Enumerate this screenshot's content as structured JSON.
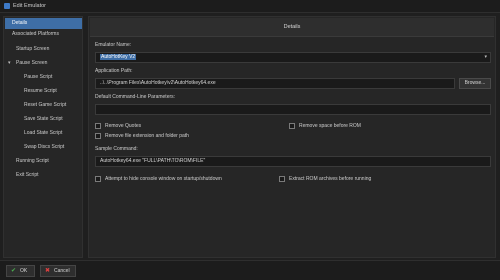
{
  "window": {
    "title": "Edit Emulator"
  },
  "sidebar": {
    "items": [
      {
        "label": "Details",
        "active": true
      },
      {
        "label": "Associated Platforms"
      },
      {
        "label": "Startup Screen"
      },
      {
        "label": "Pause Screen",
        "expandable": true
      },
      {
        "label": "Pause Script"
      },
      {
        "label": "Resume Script"
      },
      {
        "label": "Reset Game Script"
      },
      {
        "label": "Save State Script"
      },
      {
        "label": "Load State Script"
      },
      {
        "label": "Swap Discs Script"
      },
      {
        "label": "Running Script"
      },
      {
        "label": "Exit Script"
      }
    ]
  },
  "main": {
    "header": "Details",
    "emulator_name_label": "Emulator Name:",
    "emulator_name_value": "AutoHotKey V2",
    "app_path_label": "Application Path:",
    "app_path_value": "..\\..\\Program Files\\AutoHotkey\\v2\\AutoHotkey64.exe",
    "browse_label": "Browse...",
    "cmdline_label": "Default Command-Line Parameters:",
    "cmdline_value": "",
    "checkboxes": {
      "remove_quotes": "Remove Quotes",
      "remove_space": "Remove space before ROM",
      "remove_ext": "Remove file extension and folder path",
      "hide_console": "Attempt to hide console window on startup/shutdown",
      "extract_rom": "Extract ROM archives before running"
    },
    "sample_label": "Sample Command:",
    "sample_value": "AutoHotkey64.exe \"FULL\\PATH\\TO\\ROM\\FILE\""
  },
  "footer": {
    "ok_label": "OK",
    "cancel_label": "Cancel"
  },
  "colors": {
    "accent": "#3e6ea6",
    "ok_icon": "#4caf50",
    "cancel_icon": "#e04040"
  }
}
